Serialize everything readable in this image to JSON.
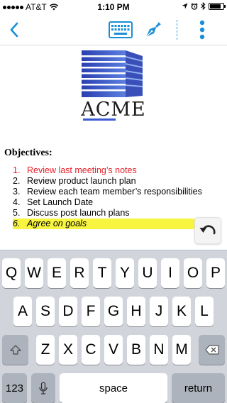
{
  "status_bar": {
    "carrier": "AT&T",
    "time": "1:10 PM",
    "battery_level": 0.85
  },
  "nav": {
    "back_icon": "chevron-left-icon",
    "keyboard_icon": "keyboard-icon",
    "pen_icon": "pen-nib-icon",
    "more_icon": "vertical-ellipsis-icon",
    "accent_color": "#1a8fd6"
  },
  "document": {
    "logo_text": "ACME",
    "heading": "Objectives:",
    "items": [
      {
        "num": "1.",
        "text": "Review last meeting’s notes",
        "style": "red"
      },
      {
        "num": "2.",
        "text": "Review product launch plan",
        "style": "normal"
      },
      {
        "num": "3.",
        "text": "Review each team member’s responsibilities",
        "style": "normal"
      },
      {
        "num": "4.",
        "text": "Set Launch Date",
        "style": "normal"
      },
      {
        "num": "5.",
        "text": "Discuss post launch plans",
        "style": "normal"
      },
      {
        "num": "6.",
        "text": "Agree on goals",
        "style": "highlight"
      }
    ],
    "undo_icon": "undo-icon"
  },
  "keyboard": {
    "row1": [
      "Q",
      "W",
      "E",
      "R",
      "T",
      "Y",
      "U",
      "I",
      "O",
      "P"
    ],
    "row2": [
      "A",
      "S",
      "D",
      "F",
      "G",
      "H",
      "J",
      "K",
      "L"
    ],
    "row3": [
      "Z",
      "X",
      "C",
      "V",
      "B",
      "N",
      "M"
    ],
    "numbers_key": "123",
    "space_key": "space",
    "return_key": "return"
  }
}
